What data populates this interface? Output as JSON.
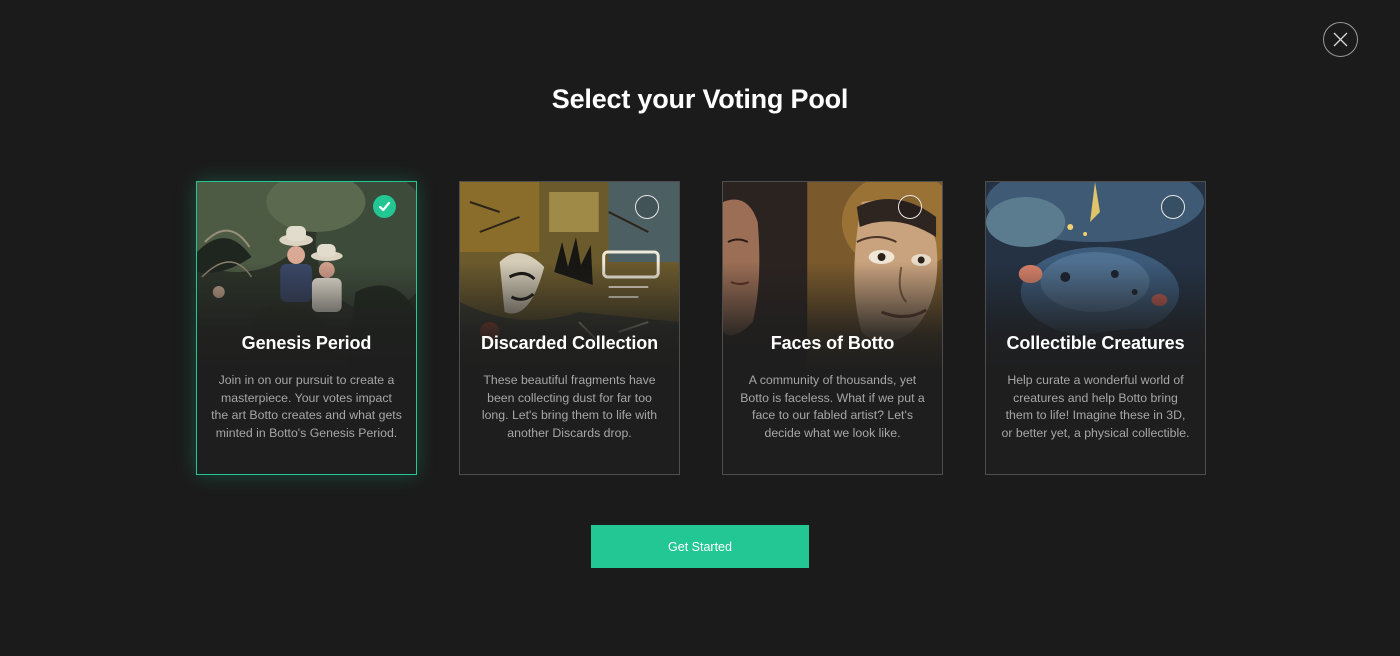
{
  "modal": {
    "title": "Select your Voting Pool",
    "close_icon": "close-icon",
    "accent_color": "#22c794"
  },
  "pools": [
    {
      "title": "Genesis Period",
      "description": "Join in on our pursuit to create a masterpiece. Your votes impact the art Botto creates and what gets minted in Botto's Genesis Period.",
      "selected": true
    },
    {
      "title": "Discarded Collection",
      "description": "These beautiful fragments have been collecting dust for far too long. Let's bring them to life with another Discards drop.",
      "selected": false
    },
    {
      "title": "Faces of Botto",
      "description": "A community of thousands, yet Botto is faceless. What if we put a face to our fabled artist? Let's decide what we look like.",
      "selected": false
    },
    {
      "title": "Collectible Creatures",
      "description": "Help curate a wonderful world of creatures and help Botto bring them to life! Imagine these in 3D, or better yet, a physical collectible.",
      "selected": false
    }
  ],
  "cta": {
    "label": "Get Started"
  }
}
